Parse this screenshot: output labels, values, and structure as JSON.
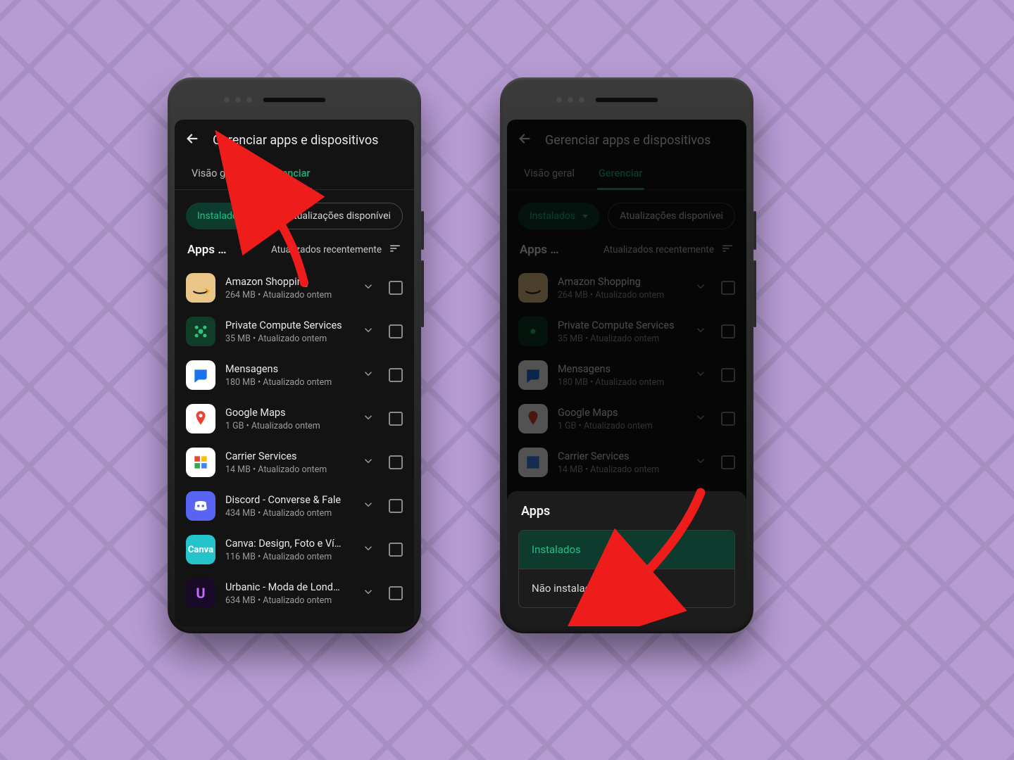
{
  "appbar": {
    "title": "Gerenciar apps e dispositivos"
  },
  "tabs": {
    "overview": "Visão geral",
    "manage": "Gerenciar"
  },
  "chips": {
    "installed": "Instalados",
    "updates": "Atualizações disponívei"
  },
  "list_header": {
    "title": "Apps …",
    "sort": "Atualizados recentemente"
  },
  "apps": [
    {
      "name": "Amazon Shopping",
      "sub": "264 MB  •  Atualizado ontem"
    },
    {
      "name": "Private Compute Services",
      "sub": "35 MB  •  Atualizado ontem"
    },
    {
      "name": "Mensagens",
      "sub": "180 MB  •  Atualizado ontem"
    },
    {
      "name": "Google Maps",
      "sub": "1 GB  •  Atualizado ontem"
    },
    {
      "name": "Carrier Services",
      "sub": "14 MB  •  Atualizado ontem"
    },
    {
      "name": "Discord - Converse & Fale",
      "sub": "434 MB  •  Atualizado ontem"
    },
    {
      "name": "Canva: Design, Foto e Ví…",
      "sub": "116 MB  •  Atualizado ontem"
    },
    {
      "name": "Urbanic - Moda de Lond…",
      "sub": "634 MB  •  Atualizado ontem"
    }
  ],
  "sheet": {
    "title": "Apps",
    "installed": "Instalados",
    "not_installed": "Não instalados"
  }
}
